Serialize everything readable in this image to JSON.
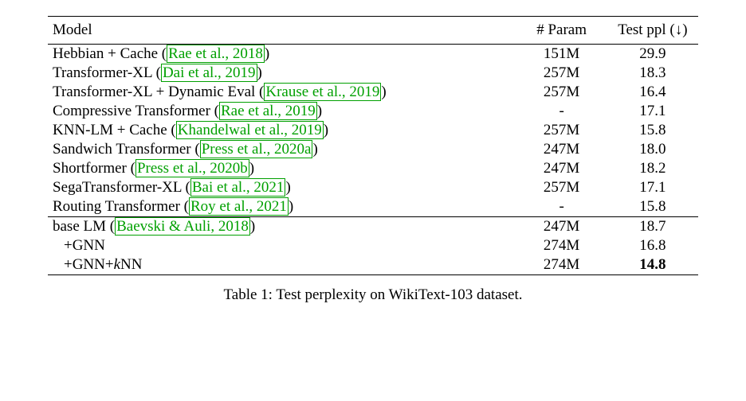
{
  "chart_data": {
    "type": "table",
    "title": "Table 1: Test perplexity on WikiText-103 dataset.",
    "columns": [
      "Model",
      "# Param",
      "Test ppl (↓)"
    ],
    "rows_group1": [
      {
        "model": "Hebbian + Cache (Rae et al., 2018)",
        "param": "151M",
        "ppl": "29.9"
      },
      {
        "model": "Transformer-XL (Dai et al., 2019)",
        "param": "257M",
        "ppl": "18.3"
      },
      {
        "model": "Transformer-XL + Dynamic Eval (Krause et al., 2019)",
        "param": "257M",
        "ppl": "16.4"
      },
      {
        "model": "Compressive Transformer (Rae et al., 2019)",
        "param": "-",
        "ppl": "17.1"
      },
      {
        "model": "KNN-LM + Cache (Khandelwal et al., 2019)",
        "param": "257M",
        "ppl": "15.8"
      },
      {
        "model": "Sandwich Transformer (Press et al., 2020a)",
        "param": "247M",
        "ppl": "18.0"
      },
      {
        "model": "Shortformer (Press et al., 2020b)",
        "param": "247M",
        "ppl": "18.2"
      },
      {
        "model": "SegaTransformer-XL (Bai et al., 2021)",
        "param": "257M",
        "ppl": "17.1"
      },
      {
        "model": "Routing Transformer (Roy et al., 2021)",
        "param": "-",
        "ppl": "15.8"
      }
    ],
    "rows_group2": [
      {
        "model": "base LM (Baevski & Auli, 2018)",
        "param": "247M",
        "ppl": "18.7"
      },
      {
        "model": "+GNN",
        "param": "274M",
        "ppl": "16.8"
      },
      {
        "model": "+GNN+kNN",
        "param": "274M",
        "ppl": "14.8"
      }
    ]
  },
  "header": {
    "col_model": "Model",
    "col_param": "# Param",
    "col_ppl_pre": "Test ppl (",
    "col_ppl_arrow": "↓",
    "col_ppl_post": ")"
  },
  "g1": {
    "r0": {
      "pre": "Hebbian + Cache (",
      "cite": "Rae et al., 2018",
      "post": ")",
      "param": "151M",
      "ppl": "29.9"
    },
    "r1": {
      "pre": "Transformer-XL (",
      "cite": "Dai et al., 2019",
      "post": ")",
      "param": "257M",
      "ppl": "18.3"
    },
    "r2": {
      "pre": "Transformer-XL + Dynamic Eval (",
      "cite": "Krause et al., 2019",
      "post": ")",
      "param": "257M",
      "ppl": "16.4"
    },
    "r3": {
      "pre": "Compressive Transformer (",
      "cite": "Rae et al., 2019",
      "post": ")",
      "param": "-",
      "ppl": "17.1"
    },
    "r4": {
      "pre": "KNN-LM + Cache (",
      "cite": "Khandelwal et al., 2019",
      "post": ")",
      "param": "257M",
      "ppl": "15.8"
    },
    "r5": {
      "pre": "Sandwich Transformer (",
      "cite": "Press et al., 2020a",
      "post": ")",
      "param": "247M",
      "ppl": "18.0"
    },
    "r6": {
      "pre": "Shortformer (",
      "cite": "Press et al., 2020b",
      "post": ")",
      "param": "247M",
      "ppl": "18.2"
    },
    "r7": {
      "pre": "SegaTransformer-XL (",
      "cite": "Bai et al., 2021",
      "post": ")",
      "param": "257M",
      "ppl": "17.1"
    },
    "r8": {
      "pre": "Routing Transformer (",
      "cite": "Roy et al., 2021",
      "post": ")",
      "param": "-",
      "ppl": "15.8"
    }
  },
  "g2": {
    "r0": {
      "pre": "base LM (",
      "cite": "Baevski & Auli, 2018",
      "post": ")",
      "param": "247M",
      "ppl": "18.7"
    },
    "r1": {
      "label": "+GNN",
      "param": "274M",
      "ppl": "16.8"
    },
    "r2": {
      "label_pre": "+GNN+",
      "label_k": "k",
      "label_post": "NN",
      "param": "274M",
      "ppl": "14.8"
    }
  },
  "caption": "Table 1: Test perplexity on WikiText-103 dataset."
}
